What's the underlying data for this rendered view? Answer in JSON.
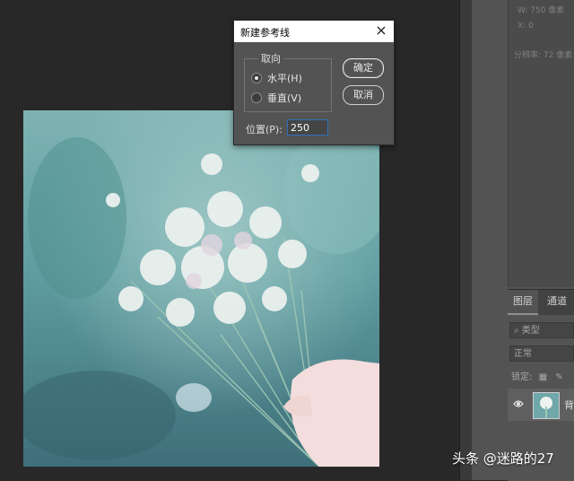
{
  "dialog": {
    "title": "新建参考线",
    "orientation_legend": "取向",
    "options": [
      {
        "label": "水平(H)",
        "selected": true
      },
      {
        "label": "垂直(V)",
        "selected": false
      }
    ],
    "ok_label": "确定",
    "cancel_label": "取消",
    "position_label": "位置(P):",
    "position_value": "250"
  },
  "info_panel": {
    "width_text": "W:  750 像素",
    "x_text": "X:  0",
    "resolution_text": "分辨率: 72 像素"
  },
  "layers_panel": {
    "tabs": [
      "图层",
      "通道"
    ],
    "search_placeholder": "类型",
    "blend_mode": "正常",
    "lock_label": "锁定:",
    "layer_name": "背"
  },
  "watermark": "头条 @迷路的27",
  "colors": {
    "app_bg": "#282828",
    "panel_bg": "#535353",
    "input_focus": "#2f6fbf"
  }
}
